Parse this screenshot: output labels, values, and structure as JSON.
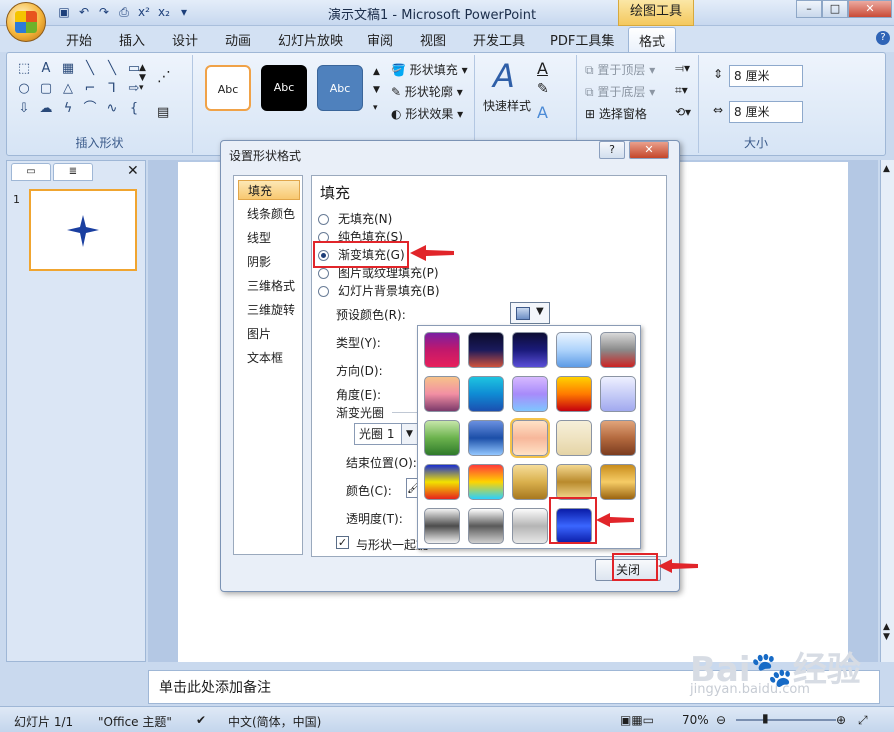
{
  "window": {
    "title": "演示文稿1 - Microsoft PowerPoint",
    "context_tab": "绘图工具"
  },
  "tabs": [
    "开始",
    "插入",
    "设计",
    "动画",
    "幻灯片放映",
    "审阅",
    "视图",
    "开发工具",
    "PDF工具集",
    "格式"
  ],
  "ribbon": {
    "insert_shapes_label": "插入形状",
    "style_samples": [
      "Abc",
      "Abc",
      "Abc"
    ],
    "shape_fill": "形状填充",
    "shape_outline": "形状轮廓",
    "shape_effects": "形状效果",
    "quick_styles": "快速样式",
    "bring_front": "置于顶层",
    "send_back": "置于底层",
    "selection_pane": "选择窗格",
    "height_value": "8 厘米",
    "width_value": "8 厘米",
    "size_label": "大小"
  },
  "slide_number": "1",
  "notes_placeholder": "单击此处添加备注",
  "status": {
    "slide": "幻灯片 1/1",
    "theme": "\"Office 主题\"",
    "language": "中文(简体，中国)",
    "zoom": "70%"
  },
  "dialog": {
    "title": "设置形状格式",
    "help": "?",
    "categories": [
      "填充",
      "线条颜色",
      "线型",
      "阴影",
      "三维格式",
      "三维旋转",
      "图片",
      "文本框"
    ],
    "heading": "填充",
    "fill_options": [
      "无填充(N)",
      "纯色填充(S)",
      "渐变填充(G)",
      "图片或纹理填充(P)",
      "幻灯片背景填充(B)"
    ],
    "selected_option": "渐变填充(G)",
    "preset_label": "预设颜色(R):",
    "type_label": "类型(Y):",
    "direction_label": "方向(D):",
    "angle_label": "角度(E):",
    "stops_label": "渐变光圈",
    "stop_value": "光圈 1",
    "end_position_label": "结束位置(O):",
    "color_label": "颜色(C):",
    "transparency_label": "透明度(T):",
    "rotate_with_shape": "与形状一起旋",
    "close_button": "关闭"
  },
  "watermark": {
    "text": "Bai🐾经验",
    "sub": "jingyan.baidu.com"
  },
  "gallery_presets": [
    {
      "name": "red-purple",
      "colors": [
        "#7a1fa2",
        "#c2186b",
        "#e8205c"
      ]
    },
    {
      "name": "night-sunset",
      "colors": [
        "#0b0b2a",
        "#1a1a5c",
        "#d1533c"
      ]
    },
    {
      "name": "deep-blue",
      "colors": [
        "#0d0d35",
        "#1a1a7a",
        "#5a4fd8"
      ]
    },
    {
      "name": "sky",
      "colors": [
        "#eaf4ff",
        "#aed3fb",
        "#5d9be6"
      ]
    },
    {
      "name": "silver-red",
      "colors": [
        "#d9d9d9",
        "#8a8a8a",
        "#c22"
      ]
    },
    {
      "name": "sunset",
      "colors": [
        "#f6c28a",
        "#f28fa3",
        "#7b3a6a"
      ]
    },
    {
      "name": "ocean",
      "colors": [
        "#1ec4e0",
        "#0f8bd4",
        "#1b4fb0"
      ]
    },
    {
      "name": "lavender",
      "colors": [
        "#d7b9ff",
        "#a78bfa",
        "#7ec6ff"
      ]
    },
    {
      "name": "fire",
      "colors": [
        "#ffd200",
        "#ff7a00",
        "#c4000e"
      ]
    },
    {
      "name": "light-periwinkle",
      "colors": [
        "#eef0ff",
        "#c7cdf7",
        "#a1a9ef"
      ]
    },
    {
      "name": "moss",
      "colors": [
        "#c6e6a9",
        "#6bb24d",
        "#2f7a2a"
      ]
    },
    {
      "name": "horizon",
      "colors": [
        "#6a90e0",
        "#1c4fa8",
        "#93c7ff"
      ]
    },
    {
      "name": "peach",
      "colors": [
        "#ffe2c6",
        "#f7b79a",
        "#ffe2c6"
      ]
    },
    {
      "name": "parchment",
      "colors": [
        "#f6efd9",
        "#efe3c1",
        "#e5d4a6"
      ]
    },
    {
      "name": "mahogany",
      "colors": [
        "#e1a47a",
        "#b46a3f",
        "#7b3c1f"
      ]
    },
    {
      "name": "rainbow",
      "colors": [
        "#1a2fd0",
        "#f2e200",
        "#e7231c"
      ]
    },
    {
      "name": "rainbow-2",
      "colors": [
        "#ff3a3a",
        "#ffd400",
        "#2ad0ff"
      ]
    },
    {
      "name": "gold",
      "colors": [
        "#f6dd9a",
        "#d9b04d",
        "#a8781f"
      ]
    },
    {
      "name": "gold-2",
      "colors": [
        "#f4d88f",
        "#b98a2c",
        "#f4d88f"
      ]
    },
    {
      "name": "brass",
      "colors": [
        "#c98d1c",
        "#f6cc66",
        "#9b6410"
      ]
    },
    {
      "name": "chrome",
      "colors": [
        "#f2f2f2",
        "#4c4c4c",
        "#f2f2f2"
      ]
    },
    {
      "name": "chrome-2",
      "colors": [
        "#ffffff",
        "#5a5a5a",
        "#cfcfcf"
      ]
    },
    {
      "name": "silver",
      "colors": [
        "#fbfbfb",
        "#b5b5b5",
        "#e8e8e8"
      ]
    },
    {
      "name": "sapphire",
      "colors": [
        "#0a1ca8",
        "#3a66ff",
        "#0a1ca8"
      ]
    }
  ],
  "colors": {
    "accent_highlight": "#e1252a",
    "ribbon": "#d6e4f5",
    "star": "#1a3fa0"
  }
}
